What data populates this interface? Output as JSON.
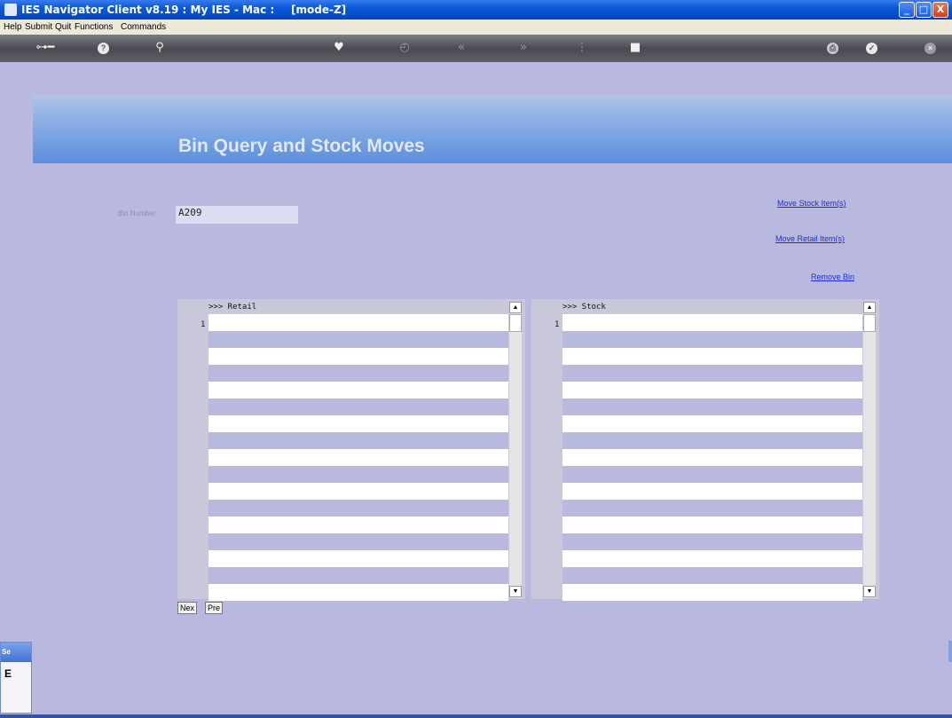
{
  "window": {
    "title": "IES Navigator Client v8.19 : My IES - Mac :",
    "mode": "[mode-Z]",
    "buttons": {
      "minimize": "_",
      "maximize": "□",
      "close": "X"
    }
  },
  "menu": [
    "Help",
    "Submit",
    "Quit",
    "Functions",
    "Commands"
  ],
  "toolbar": {
    "icons": [
      "key-icon",
      "help-icon",
      "search-icon",
      "heart-icon",
      "clock-icon",
      "rewind-icon",
      "forward-icon",
      "list-icon",
      "stop-icon",
      "print-icon",
      "ok-icon",
      "cancel-icon"
    ]
  },
  "page": {
    "heading": "Bin Query and Stock Moves",
    "bin_number_label": "Bin Number",
    "bin_number_value": "A209"
  },
  "links": {
    "move_stock": "Move Stock Item(s)",
    "move_retail": "Move Retail Item(s)",
    "remove_bin": "Remove Bin"
  },
  "grids": {
    "retail": {
      "header": ">>> Retail",
      "row_number": "1"
    },
    "stock": {
      "header": ">>> Stock",
      "row_number": "1"
    }
  },
  "pager": {
    "next": "Nex",
    "prev": "Pre"
  },
  "side_panel": {
    "caption": "Se",
    "char": "E"
  },
  "colors": {
    "background": "#b9b9e0",
    "banner": "#5a90dc",
    "link": "#1a2dd6"
  }
}
